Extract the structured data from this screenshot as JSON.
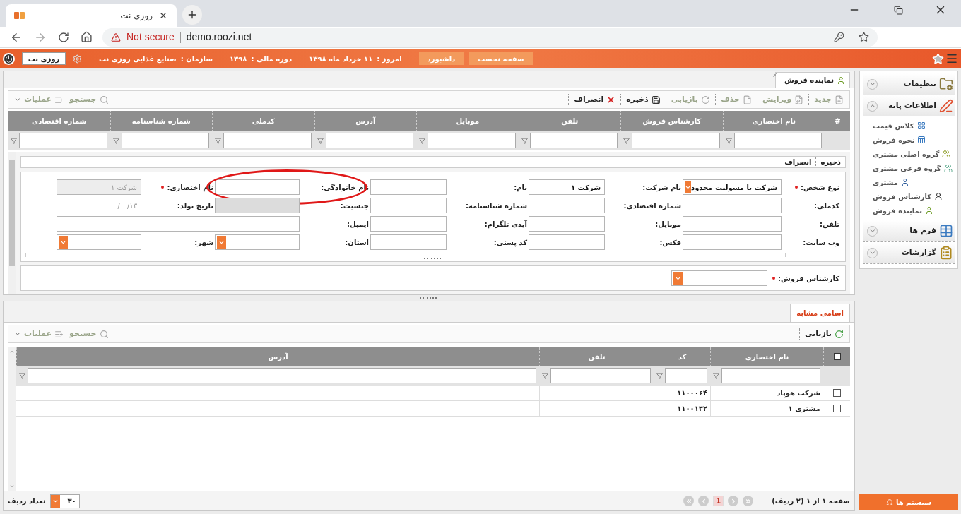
{
  "browser": {
    "tab_title": "روزی نت",
    "security": "Not secure",
    "url": "demo.roozi.net"
  },
  "app_bar": {
    "buttons": [
      "صفحه نخست",
      "داشبورد"
    ],
    "items": [
      {
        "label": "امروز :",
        "value": "۱۱ خرداد ماه ۱۳۹۸"
      },
      {
        "label": "دوره مالی :",
        "value": "۱۳۹۸"
      },
      {
        "label": "سازمان :",
        "value": "صنایع غذایی روزی نت"
      }
    ],
    "user": "روزی نت"
  },
  "page_tab": {
    "label": "نماینده فروش",
    "selected": true
  },
  "toolbar": {
    "actions": [
      {
        "label": "جدید",
        "kind": "new",
        "disabled": true
      },
      {
        "label": "ویرایش",
        "kind": "edit",
        "disabled": true
      },
      {
        "label": "حذف",
        "kind": "delete",
        "disabled": true
      },
      {
        "label": "بازیابی",
        "kind": "restore",
        "disabled": true
      },
      {
        "label": "ذخیره",
        "kind": "save",
        "disabled": false
      },
      {
        "label": "انصراف",
        "kind": "cancel",
        "disabled": false
      }
    ],
    "tools": [
      {
        "label": "جستجو",
        "kind": "search",
        "disabled": true
      },
      {
        "label": "عملیات",
        "kind": "operations",
        "disabled": true
      }
    ]
  },
  "grid": {
    "columns": [
      "#",
      "نام اختصاری",
      "کارشناس فروش",
      "تلفن",
      "موبایل",
      "آدرس",
      "کدملی",
      "شماره شناسنامه",
      "شماره اقتصادی"
    ]
  },
  "form": {
    "actions": [
      "ذخیره",
      "انصراف"
    ],
    "rows": [
      [
        {
          "label": "نوع شخص:",
          "kind": "select",
          "required": true,
          "disabled": false,
          "circled": false,
          "value": "شرکت با مسولیت محدود"
        },
        {
          "label": "نام شرکت:",
          "kind": "text",
          "required": false,
          "disabled": false,
          "circled": false,
          "value": "شرکت ۱"
        },
        {
          "label": "نام:",
          "kind": "text",
          "required": false,
          "disabled": false,
          "circled": false
        },
        {
          "label": "نام خانوادگی:",
          "kind": "text",
          "required": false,
          "disabled": false,
          "circled": true
        },
        {
          "label": "نام اختصاری:",
          "kind": "text",
          "required": true,
          "disabled": true,
          "circled": false,
          "value": "شرکت ۱"
        }
      ],
      [
        {
          "label": "کدملی:",
          "kind": "text",
          "required": false,
          "disabled": false,
          "circled": false
        },
        {
          "label": "شماره اقتصادی:",
          "kind": "text",
          "required": false,
          "disabled": false,
          "circled": false
        },
        {
          "label": "شماره شناسنامه:",
          "kind": "text",
          "required": false,
          "disabled": false,
          "circled": false
        },
        {
          "label": "جنسیت:",
          "kind": "locked",
          "required": false,
          "disabled": true,
          "circled": false
        },
        {
          "label": "تاریخ تولد:",
          "kind": "date",
          "required": false,
          "disabled": false,
          "circled": false,
          "placeholder": "__/__/۱۳"
        }
      ],
      [
        {
          "label": "تلفن:",
          "kind": "text",
          "required": false,
          "disabled": false,
          "circled": false
        },
        {
          "label": "موبایل:",
          "kind": "text",
          "required": false,
          "disabled": false,
          "circled": false
        },
        {
          "label": "آیدی تلگرام:",
          "kind": "text",
          "required": false,
          "disabled": false,
          "circled": false
        },
        {
          "label": "ایمیل:",
          "kind": "wide",
          "required": false,
          "disabled": false,
          "circled": false
        }
      ],
      [
        {
          "label": "وب سایت:",
          "kind": "text",
          "required": false,
          "disabled": false,
          "circled": false
        },
        {
          "label": "فکس:",
          "kind": "text",
          "required": false,
          "disabled": false,
          "circled": false
        },
        {
          "label": "کد پستی:",
          "kind": "text",
          "required": false,
          "disabled": false,
          "circled": false
        },
        {
          "label": "استان:",
          "kind": "select",
          "required": false,
          "disabled": false,
          "circled": false
        },
        {
          "label": "شهر:",
          "kind": "select",
          "required": false,
          "disabled": false,
          "circled": false
        }
      ]
    ],
    "sales_expert": {
      "label": "کارشناس فروش:",
      "kind": "select",
      "required": true,
      "disabled": false,
      "circled": false
    }
  },
  "similar": {
    "tab": {
      "label": "اسامی مشابه",
      "selected": true
    },
    "actions": [
      {
        "label": "بازیابی",
        "kind": "restore",
        "disabled": false
      }
    ],
    "tools": [
      {
        "label": "جستجو",
        "kind": "search",
        "disabled": true
      },
      {
        "label": "عملیات",
        "kind": "operations",
        "disabled": true
      }
    ],
    "select_all": {
      "checked": false
    },
    "columns": [
      "نام اختصاری",
      "کد",
      "تلفن",
      "آدرس"
    ],
    "rows": [
      {
        "checked": false,
        "name": "شرکت هوپاد",
        "code": "۱۱۰۰۰۶۴"
      },
      {
        "checked": false,
        "name": "مشتری ۱",
        "code": "۱۱۰۰۱۳۲"
      }
    ],
    "pager": {
      "summary": "صفحه ۱ از ۱ (۲ ردیف)",
      "page": "1",
      "rows_value": "۳۰",
      "rows_label": "تعداد ردیف"
    }
  },
  "sidebar": {
    "groups": [
      {
        "label": "تنظیمات",
        "kind": "settings",
        "expanded": false
      },
      {
        "label": "اطلاعات پایه",
        "kind": "base",
        "expanded": true,
        "children": [
          {
            "label": "کلاس قیمت",
            "kind": "grid"
          },
          {
            "label": "نحوه فروش",
            "kind": "table"
          },
          {
            "label": "گروه اصلی مشتری",
            "kind": "group"
          },
          {
            "label": "گروه فرعی مشتری",
            "kind": "subgroup"
          },
          {
            "label": "مشتری",
            "kind": "user"
          },
          {
            "label": "کارشناس فروش",
            "kind": "expert"
          },
          {
            "label": "نماینده فروش",
            "kind": "rep"
          }
        ]
      },
      {
        "label": "فرم ها",
        "kind": "forms",
        "expanded": false
      },
      {
        "label": "گزارشات",
        "kind": "reports",
        "expanded": false
      }
    ],
    "footer_button": "سیستم ها"
  }
}
